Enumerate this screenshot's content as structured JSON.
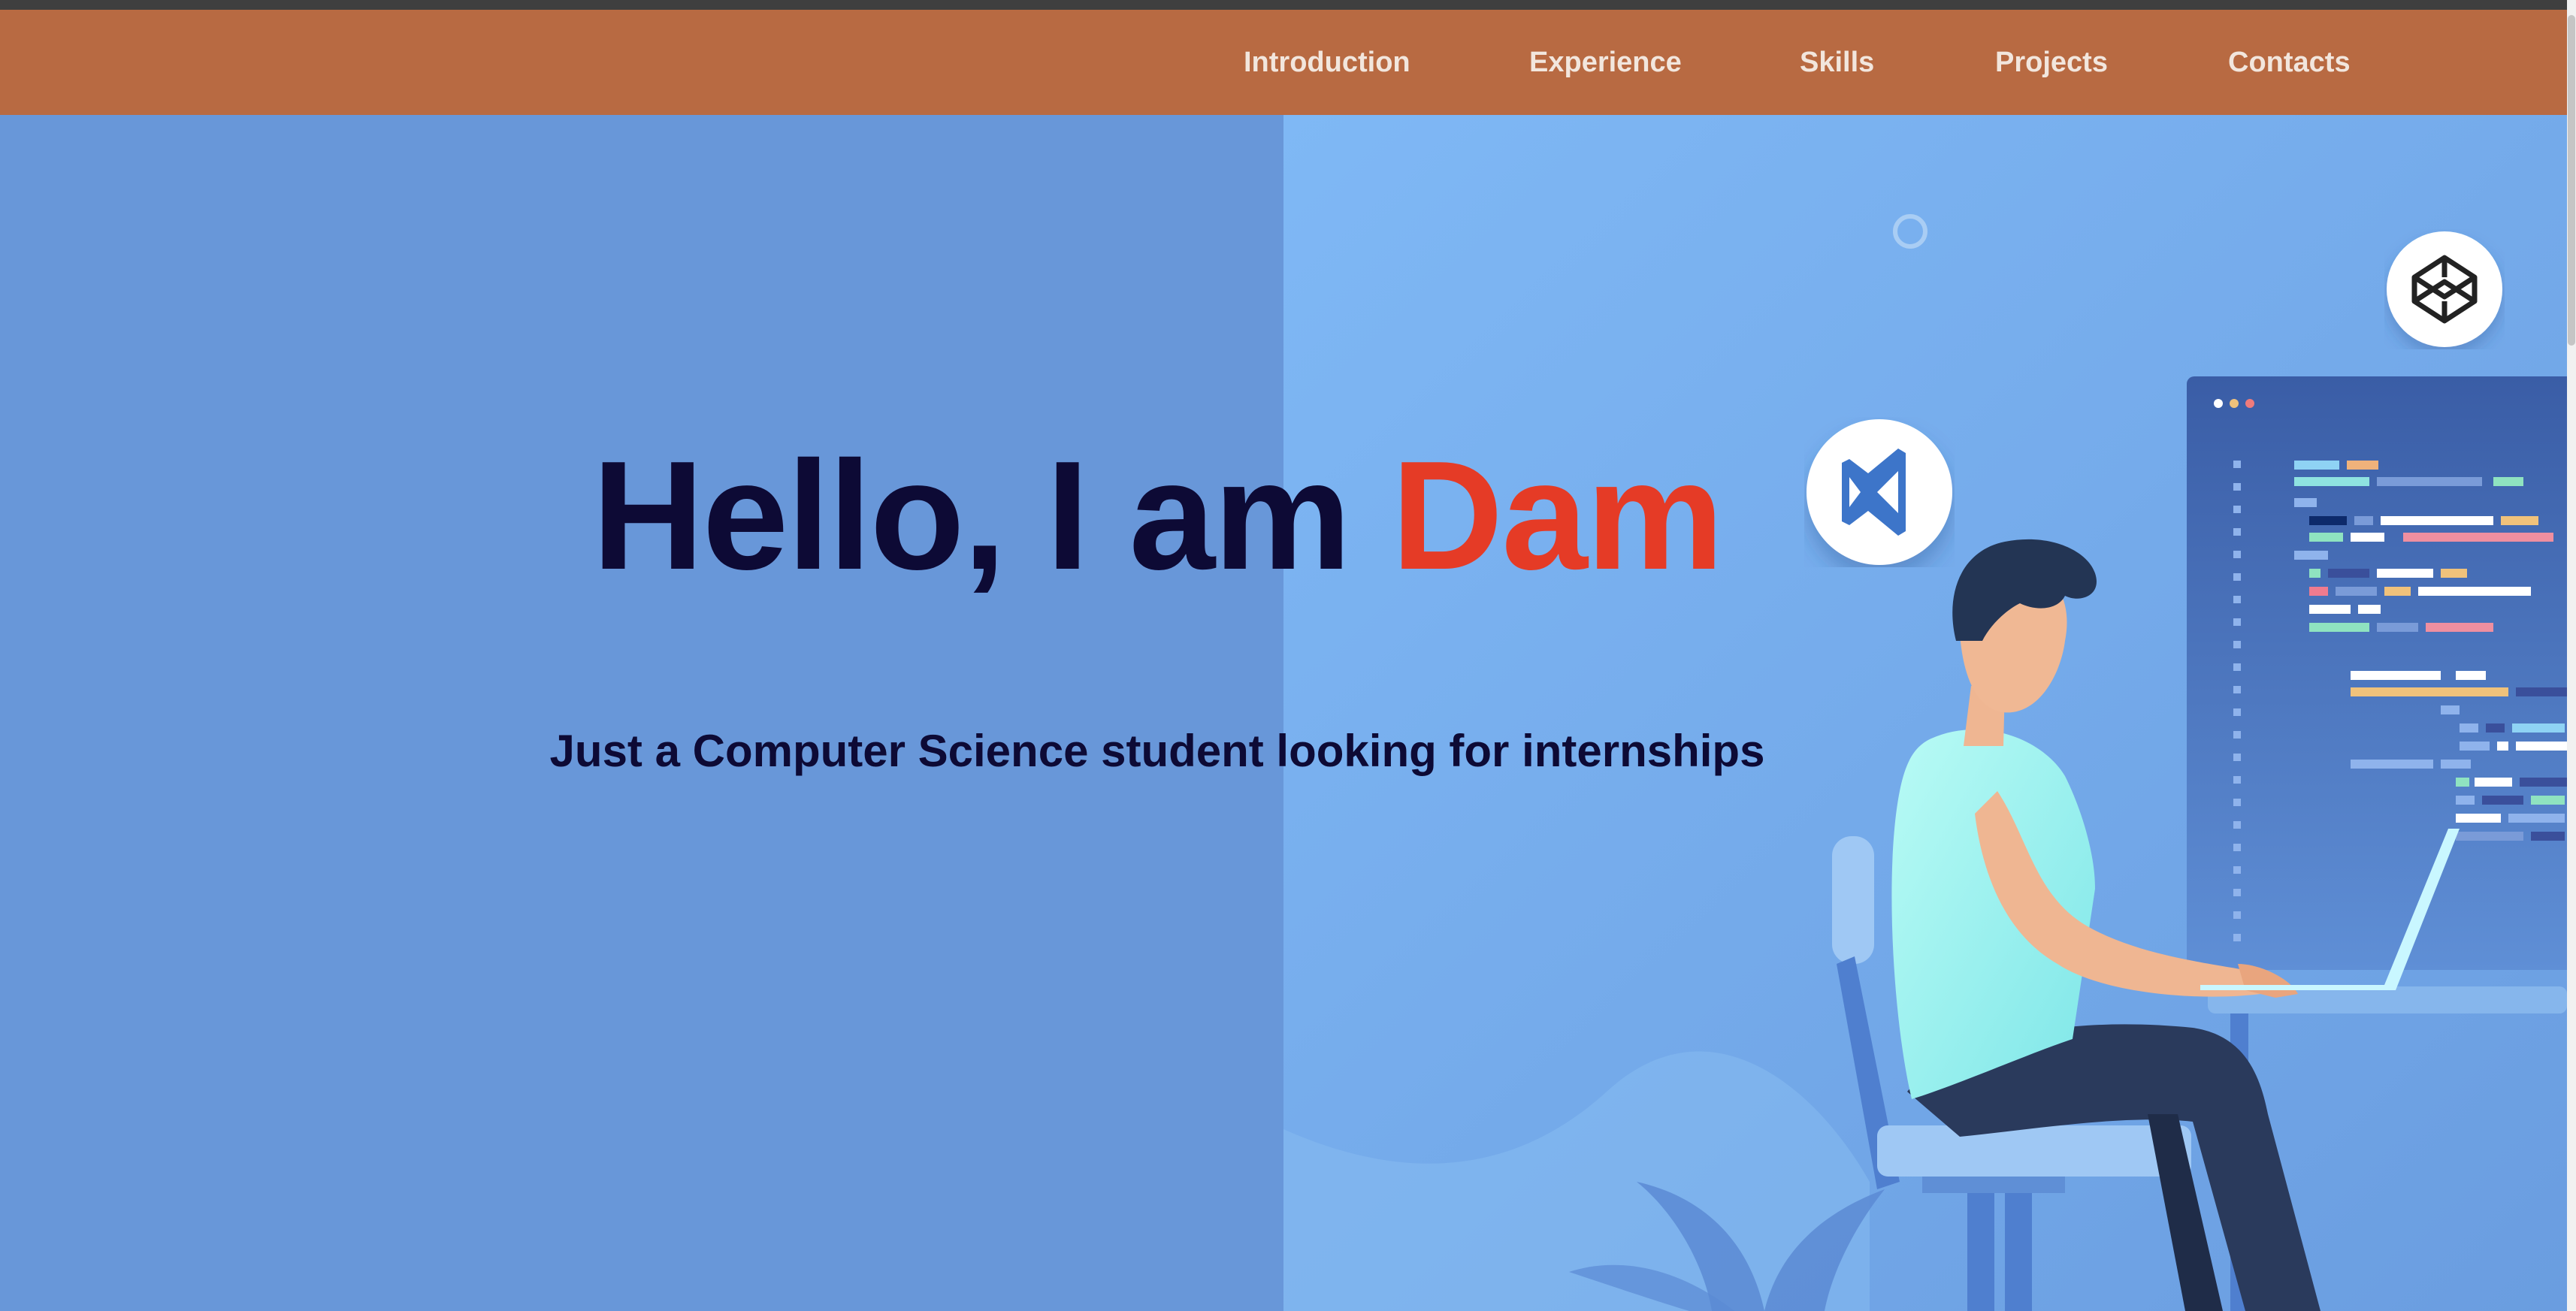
{
  "nav": {
    "items": [
      {
        "label": "Introduction"
      },
      {
        "label": "Experience"
      },
      {
        "label": "Skills"
      },
      {
        "label": "Projects"
      },
      {
        "label": "Contacts"
      }
    ]
  },
  "hero": {
    "greeting": "Hello, I am ",
    "name": "Dam",
    "tagline": "Just a Computer Science student looking for internships"
  },
  "icons": {
    "vscode": "vscode-icon",
    "codepen": "codepen-icon"
  },
  "colors": {
    "navbar": "#b86a42",
    "hero_bg": "#6897d9",
    "art_bg": "#7cb4f2",
    "headline": "#0d0a35",
    "accent_name": "#e53b26"
  }
}
